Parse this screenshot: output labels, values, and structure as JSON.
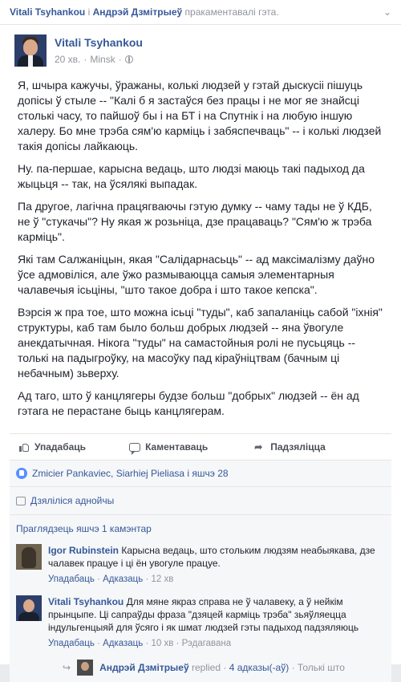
{
  "header": {
    "author1": "Vitali Tsyhankou",
    "connector": "і",
    "author2": "Андрэй Дзмітрыеў",
    "action": "пракаментавалі гэта.",
    "more": "⌄"
  },
  "post": {
    "author": "Vitali Tsyhankou",
    "time": "20 хв.",
    "sep": "·",
    "location": "Minsk",
    "loc_sep": "·",
    "paragraphs": [
      "Я, шчыра кажучы, ўражаны, колькі людзей у гэтай дыскусіі пішуць допісы ў стыле -- \"Калі б я застаўся без працы і не мог яе знайсці столькі часу, то пайшоў бы і на БТ і на Спутнік і на любую іншую халеру. Бо мне трэба сям'ю карміць і забяспечваць\" -- і колькі людзей такія допісы лайкаюць.",
      "Ну. па-першае, карысна ведаць, што людзі маюць такі падыход да жыцьця -- так, на ўсялякі выпадак.",
      "Па другое, лагічна працягваючы гэтую думку -- чаму тады не ў КДБ, не ў \"стукачы\"? Ну якая ж розьніца, дзе працаваць? \"Сям'ю ж трэба карміць\".",
      "Які там Салжаніцын, якая \"Салідарнасьць\" -- ад максімалізму даўно ўсе адмовіліся, але ўжо размываюцца самыя элементарныя чалавечыя ісьціны, \"што такое добра і што такое кепска\".",
      "Вэрсія ж пра тое, што можна ісьці \"туды\", каб запаланіць сабой \"іхнія\" структуры, каб там было больш добрых людзей -- яна ўвогуле анекдатычная. Нікога \"туды\" на самастойныя ролі не пусьцяць -- толькі на падыгроўку, на масоўку пад кіраўніцтвам (бачным ці небачным) зьверху.",
      "Ад таго, што ў канцлягеры будзе больш \"добрых\" людзей -- ён ад гэтага не перастане быць канцлягерам."
    ]
  },
  "actions": {
    "like": "Упадабаць",
    "comment": "Каментаваць",
    "share": "Падзяліцца"
  },
  "feedback": {
    "likes": "Zmicier Pankaviec, Siarhiej Pieliasa і яшчэ 28",
    "shares": "Дзяліліся аднойчы",
    "more_comments": "Праглядзець яшчэ 1 камэнтар"
  },
  "comments": [
    {
      "author": "Igor Rubinstein",
      "text": "Карысна ведаць, што стольким людзям неабыякава, дзе чалавек працуе і ці ён увогуле працуе.",
      "like": "Упадабаць",
      "reply": "Адказаць",
      "time": "12 хв"
    },
    {
      "author": "Vitali Tsyhankou",
      "text": "Для мяне якраз справа не ў чалавеку, а ў нейкім прынцыпе. Ці сапраўды фраза \"дзяцей карміць трэба\" зьяўляецца індульгенцыяй для ўсяго і як шмат людзей гэты падыход падзяляюць",
      "like": "Упадабаць",
      "reply": "Адказаць",
      "time": "10 хв",
      "edit": "Рэдагавана"
    }
  ],
  "reply_summary": {
    "name": "Андрэй Дзмітрыеў",
    "label": "replied",
    "sep": "·",
    "count": "4 адказы(-аў)",
    "ago": "Толькі што"
  }
}
